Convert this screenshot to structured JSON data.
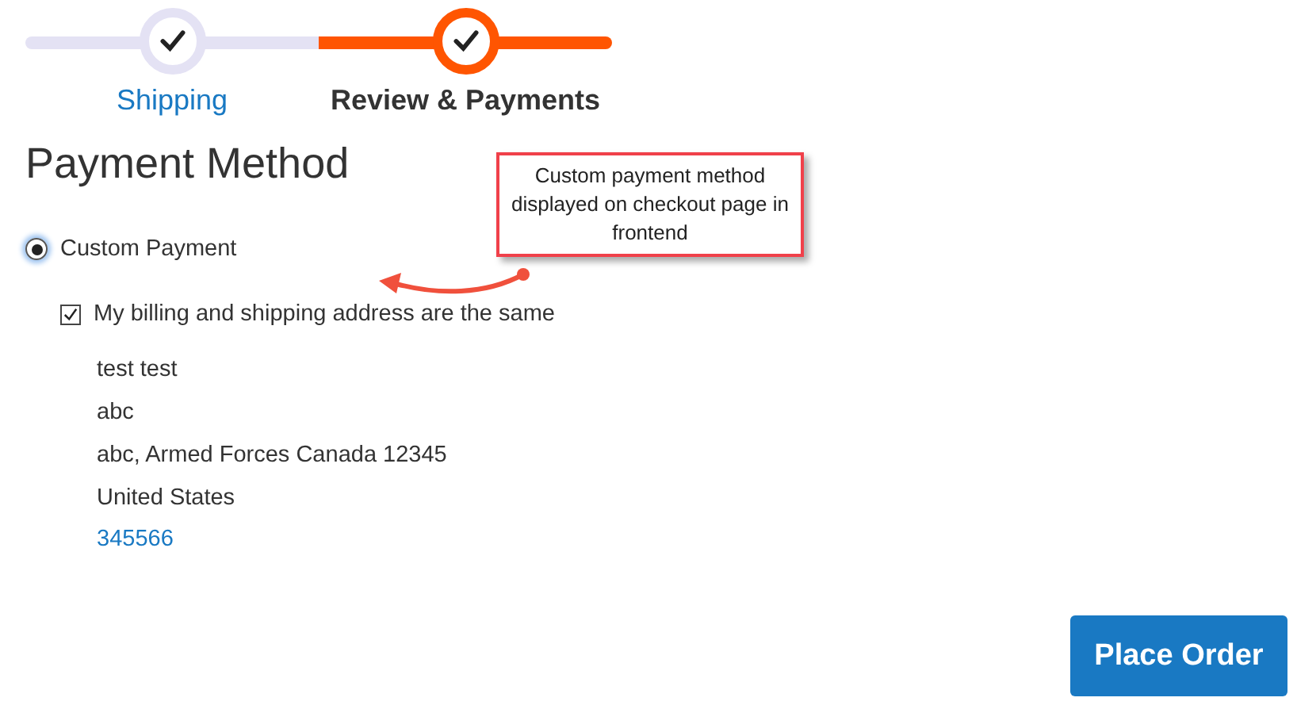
{
  "steps": [
    {
      "label": "Shipping",
      "selected": false
    },
    {
      "label": "Review & Payments",
      "selected": true
    }
  ],
  "heading": "Payment Method",
  "payment_methods": [
    {
      "label": "Custom Payment",
      "selected": true
    }
  ],
  "billing_same": {
    "label": "My billing and shipping address are the same",
    "checked": true
  },
  "address": {
    "lines": [
      "test test",
      "abc",
      "abc, Armed Forces Canada 12345",
      "United States"
    ],
    "phone": "345566"
  },
  "callout": "Custom payment method displayed on checkout page in frontend",
  "place_order": "Place Order"
}
